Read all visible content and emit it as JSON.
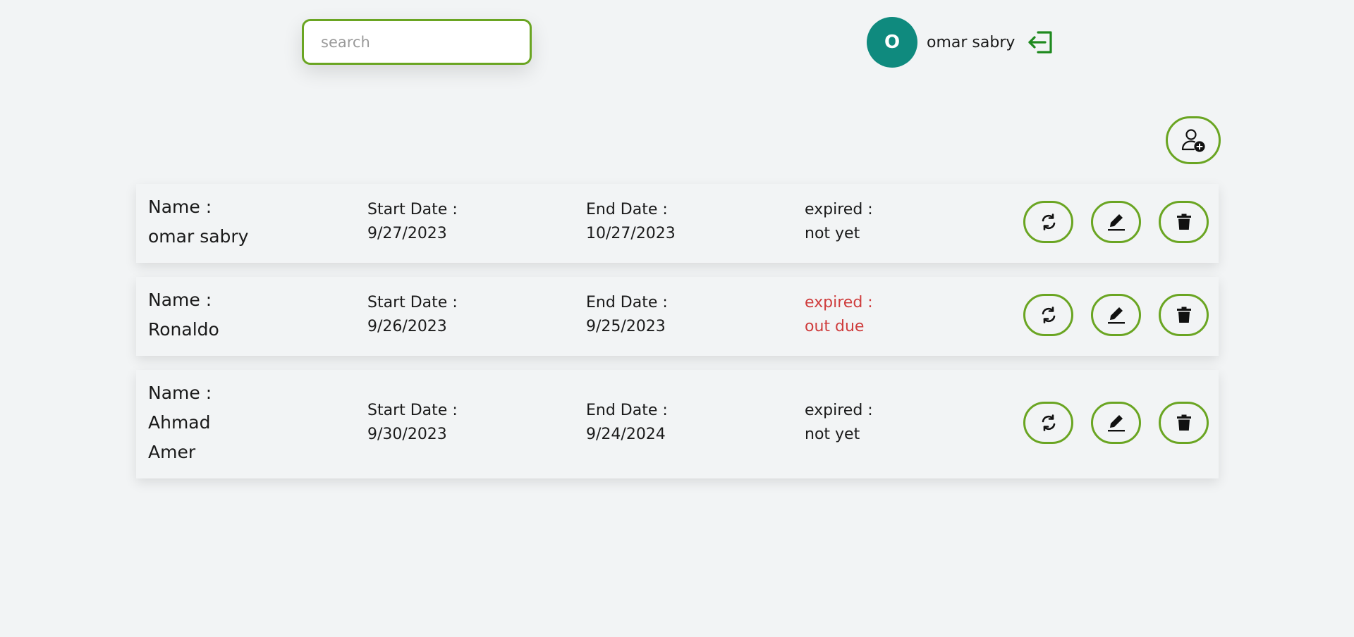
{
  "search": {
    "placeholder": "search",
    "value": ""
  },
  "user": {
    "avatar_initial": "O",
    "name": "omar sabry"
  },
  "icons": {
    "logout": "logout-icon",
    "add_user": "add-user-icon",
    "renew": "refresh-icon",
    "edit": "pencil-icon",
    "delete": "trash-icon"
  },
  "colors": {
    "accent": "#6aa522",
    "avatar_bg": "#0f8a7e",
    "expired": "#cf3d3d",
    "logout": "#1f8a1f"
  },
  "labels": {
    "name": "Name :",
    "start": "Start Date :",
    "end": "End Date :",
    "expired": "expired :"
  },
  "members": [
    {
      "name_line1": "omar sabry",
      "name_line2": "",
      "start_date": "9/27/2023",
      "end_date": "10/27/2023",
      "expired": "not yet",
      "is_expired": false
    },
    {
      "name_line1": "Ronaldo",
      "name_line2": "",
      "start_date": "9/26/2023",
      "end_date": "9/25/2023",
      "expired": "out due",
      "is_expired": true
    },
    {
      "name_line1": "Ahmad",
      "name_line2": "Amer",
      "start_date": "9/30/2023",
      "end_date": "9/24/2024",
      "expired": "not yet",
      "is_expired": false
    }
  ]
}
